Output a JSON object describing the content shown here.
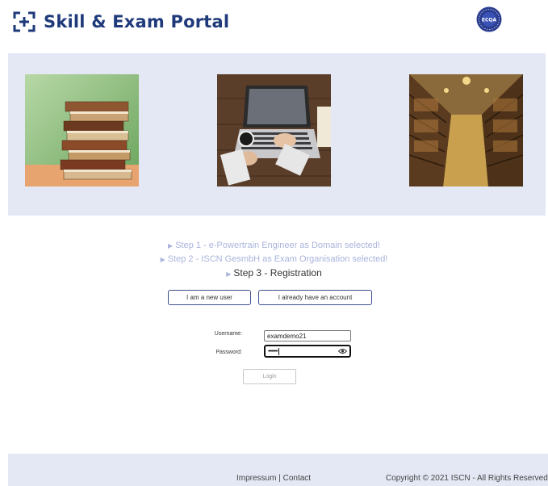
{
  "header": {
    "title": "Skill & Exam Portal",
    "seal_text": "ECQA"
  },
  "banner": {
    "images": [
      "books-photo",
      "laptop-photo",
      "library-photo"
    ]
  },
  "steps": [
    {
      "arrow": "▶",
      "text": "Step 1 - e-Powertrain Engineer as Domain selected!",
      "state": "done"
    },
    {
      "arrow": "▶",
      "text": "Step 2 - ISCN GesmbH as Exam Organisation selected!",
      "state": "done"
    },
    {
      "arrow": "▶",
      "text": "Step 3 - Registration",
      "state": "current"
    }
  ],
  "account_buttons": {
    "new_user": "I am a new user",
    "existing": "I already have an account"
  },
  "login_form": {
    "username_label": "Username:",
    "username_value": "examdemo21",
    "password_label": "Password:",
    "password_value": "••••••••",
    "login_button": "Login"
  },
  "footer": {
    "impressum": "Impressum",
    "separator": " | ",
    "contact": "Contact",
    "copyright": "Copyright © 2021 ISCN - All Rights Reserved"
  },
  "colors": {
    "brand": "#1f3a7a",
    "banner_bg": "#e4e8f4",
    "step_done": "#aab4dc",
    "button_border": "#3d4f8f"
  }
}
